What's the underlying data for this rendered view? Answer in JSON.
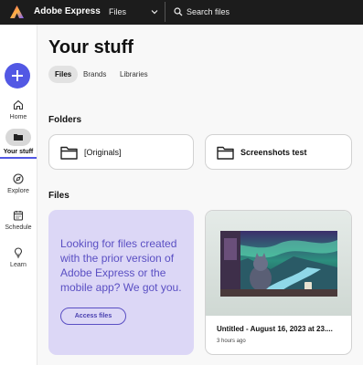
{
  "topbar": {
    "app_title": "Adobe Express",
    "search_scope": "Files",
    "search_placeholder": "Search files"
  },
  "sidebar": {
    "create_icon": "plus-icon",
    "items": [
      {
        "label": "Home",
        "icon": "home-icon"
      },
      {
        "label": "Your stuff",
        "icon": "folder-icon",
        "active": true
      },
      {
        "label": "Explore",
        "icon": "compass-icon"
      },
      {
        "label": "Schedule",
        "icon": "calendar-icon"
      },
      {
        "label": "Learn",
        "icon": "lightbulb-icon"
      }
    ]
  },
  "main": {
    "title": "Your stuff",
    "tabs": [
      {
        "label": "Files",
        "active": true
      },
      {
        "label": "Brands"
      },
      {
        "label": "Libraries"
      }
    ],
    "folders_heading": "Folders",
    "folders": [
      {
        "name": "[Originals]"
      },
      {
        "name": "Screenshots test"
      }
    ],
    "files_heading": "Files",
    "promo": {
      "text": "Looking for files created with the prior version of Adobe Express or the mobile app? We got you.",
      "button": "Access files"
    },
    "file_card": {
      "title": "Untitled - August 16, 2023 at 23....",
      "meta": "3 hours ago"
    }
  },
  "colors": {
    "accent": "#5258e4",
    "topbar": "#1c1c1c",
    "promo_bg": "#dcd7f6",
    "promo_text": "#5a4fc3"
  }
}
